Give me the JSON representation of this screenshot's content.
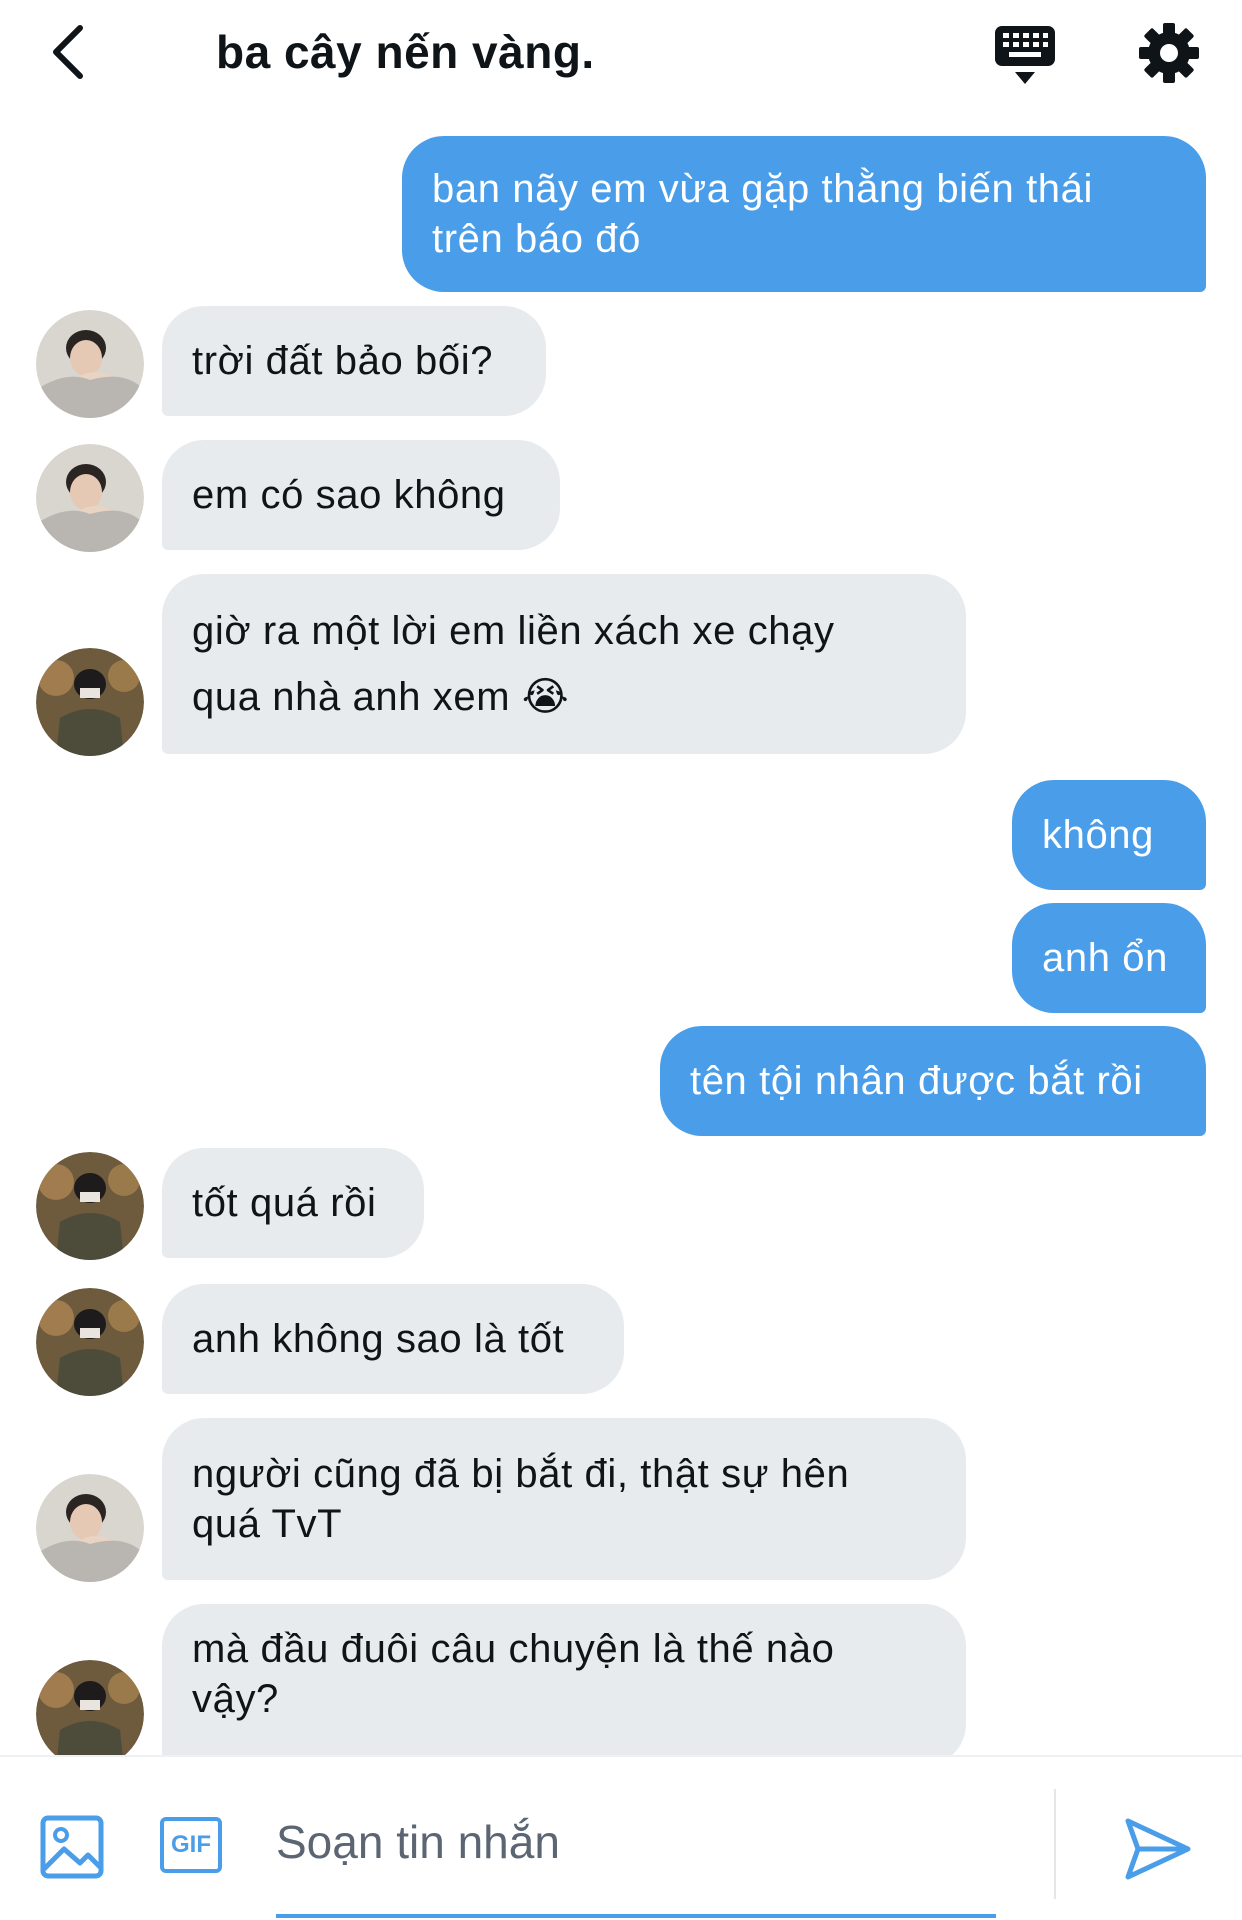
{
  "header": {
    "title": "ba cây nến vàng.",
    "back_icon": "chevron-left-icon",
    "keyboard_icon": "keyboard-icon",
    "settings_icon": "gear-icon"
  },
  "messages": [
    {
      "side": "out",
      "text": "ban nãy em vừa gặp thằng biến thái\ntrên báo đó"
    },
    {
      "side": "in",
      "avatar": "a",
      "text": "trời đất bảo bối?"
    },
    {
      "side": "in",
      "avatar": "a",
      "text": "em có sao không"
    },
    {
      "side": "in",
      "avatar": "b",
      "text": "giờ ra một lời em liền xách xe chạy\nqua nhà anh xem 😭"
    },
    {
      "side": "out",
      "text": "không"
    },
    {
      "side": "out",
      "text": "anh ổn"
    },
    {
      "side": "out",
      "text": "tên tội nhân được bắt rồi"
    },
    {
      "side": "in",
      "avatar": "b",
      "text": "tốt quá rồi"
    },
    {
      "side": "in",
      "avatar": "b",
      "text": "anh không sao là tốt"
    },
    {
      "side": "in",
      "avatar": "a",
      "text": "người cũng đã bị bắt đi, thật sự hên\nquá TvT"
    },
    {
      "side": "in",
      "avatar": "b",
      "text": "mà đầu đuôi câu chuyện là thế nào\nvậy?"
    }
  ],
  "composer": {
    "placeholder": "Soạn tin nhắn",
    "value": "",
    "gif_label": "GIF",
    "media_icon": "image-icon",
    "send_icon": "send-icon"
  },
  "colors": {
    "accent": "#4a9de8",
    "incoming_bubble": "#e8ebee",
    "text": "#0f1419"
  }
}
